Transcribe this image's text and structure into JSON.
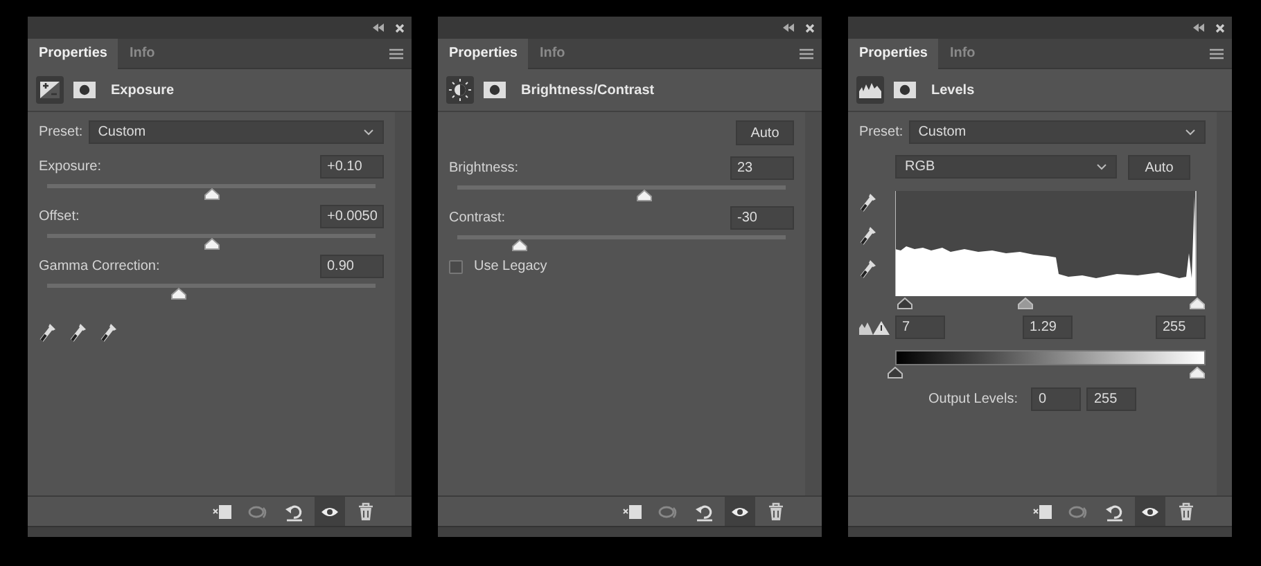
{
  "panels": [
    {
      "kind": "exposure",
      "tabs": [
        {
          "label": "Properties",
          "selected": true
        },
        {
          "label": "Info",
          "selected": false
        }
      ],
      "title": "Exposure",
      "preset": {
        "label": "Preset:",
        "value": "Custom"
      },
      "sliders": [
        {
          "label": "Exposure:",
          "value": "+0.10",
          "level": 0.5
        },
        {
          "label": "Offset:",
          "value": "+0.0050",
          "level": 0.5
        },
        {
          "label": "Gamma Correction:",
          "value": "0.90",
          "level": 0.4
        }
      ],
      "visibility_on": true
    },
    {
      "kind": "brightness",
      "tabs": [
        {
          "label": "Properties",
          "selected": true
        },
        {
          "label": "Info",
          "selected": false
        }
      ],
      "title": "Brightness/Contrast",
      "auto": "Auto",
      "sliders": [
        {
          "label": "Brightness:",
          "value": "23",
          "level": 0.57
        },
        {
          "label": "Contrast:",
          "value": "-30",
          "level": 0.19
        }
      ],
      "checkbox": {
        "label": "Use Legacy",
        "checked": false
      },
      "visibility_on": true
    },
    {
      "kind": "levels",
      "tabs": [
        {
          "label": "Properties",
          "selected": true
        },
        {
          "label": "Info",
          "selected": false
        }
      ],
      "title": "Levels",
      "preset": {
        "label": "Preset:",
        "value": "Custom"
      },
      "channel": "RGB",
      "auto": "Auto",
      "input_thumbs": [
        {
          "level": 0.03
        },
        {
          "level": 0.43
        },
        {
          "level": 1
        }
      ],
      "input_values": [
        "7",
        "1.29",
        "255"
      ],
      "output_thumbs": [
        {
          "level": 0
        },
        {
          "level": 1
        }
      ],
      "output_label": "Output Levels:",
      "output_values": [
        "0",
        "255"
      ],
      "visibility_on": true
    }
  ]
}
